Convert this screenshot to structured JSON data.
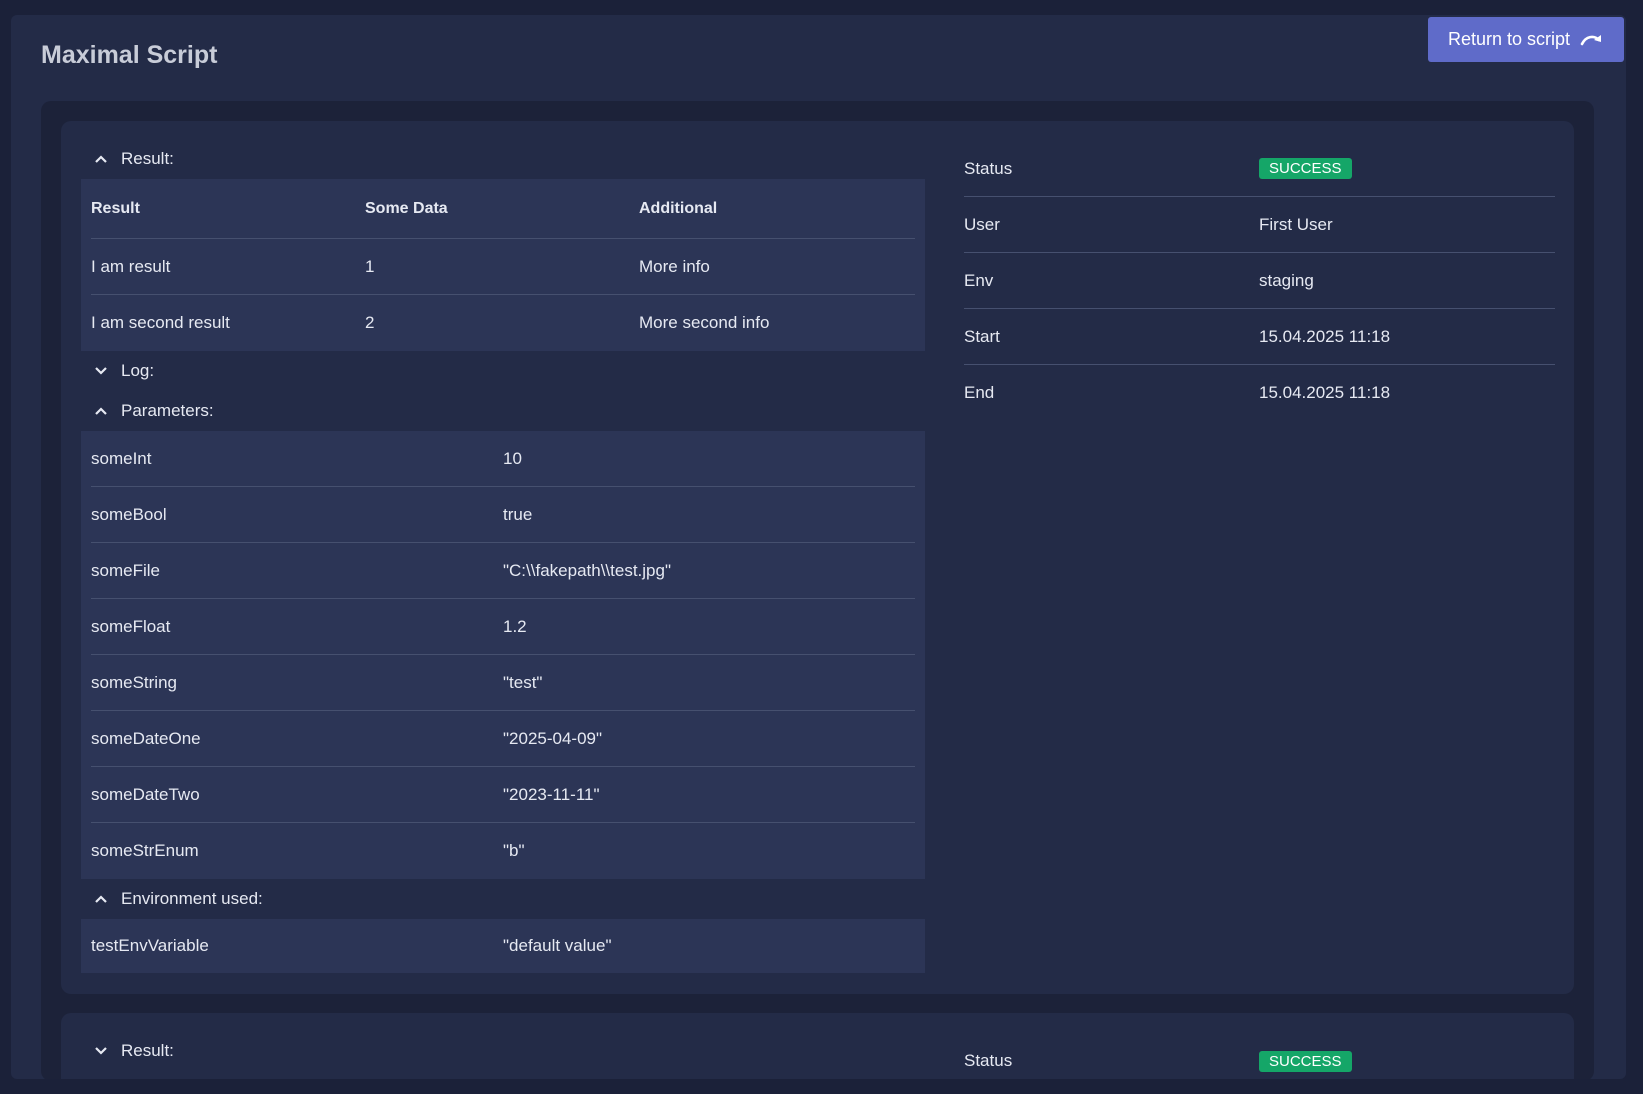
{
  "page": {
    "title": "Maximal Script",
    "return_label": "Return to script"
  },
  "result_section": {
    "label": "Result:",
    "columns": [
      "Result",
      "Some Data",
      "Additional"
    ],
    "rows": [
      [
        "I am result",
        "1",
        "More info"
      ],
      [
        "I am second result",
        "2",
        "More second info"
      ]
    ]
  },
  "log_section": {
    "label": "Log:"
  },
  "parameters_section": {
    "label": "Parameters:",
    "rows": [
      [
        "someInt",
        "10"
      ],
      [
        "someBool",
        "true"
      ],
      [
        "someFile",
        "\"C:\\\\fakepath\\\\test.jpg\""
      ],
      [
        "someFloat",
        "1.2"
      ],
      [
        "someString",
        "\"test\""
      ],
      [
        "someDateOne",
        "\"2025-04-09\""
      ],
      [
        "someDateTwo",
        "\"2023-11-11\""
      ],
      [
        "someStrEnum",
        "\"b\""
      ]
    ]
  },
  "environment_section": {
    "label": "Environment used:",
    "rows": [
      [
        "testEnvVariable",
        "\"default value\""
      ]
    ]
  },
  "info": [
    {
      "key": "Status",
      "value": "SUCCESS",
      "badge": true
    },
    {
      "key": "User",
      "value": "First User"
    },
    {
      "key": "Env",
      "value": "staging"
    },
    {
      "key": "Start",
      "value": "15.04.2025 11:18"
    },
    {
      "key": "End",
      "value": "15.04.2025 11:18"
    }
  ],
  "second_card": {
    "result_label": "Result:",
    "status_key": "Status",
    "status_value": "SUCCESS"
  },
  "colors": {
    "accent": "#5f6bc9",
    "success": "#15a668",
    "panel": "#2c3556",
    "background": "#1b2139"
  },
  "icons": {
    "return": "redo-arrow-icon",
    "expanded": "chevron-up-icon",
    "collapsed": "chevron-down-icon"
  }
}
